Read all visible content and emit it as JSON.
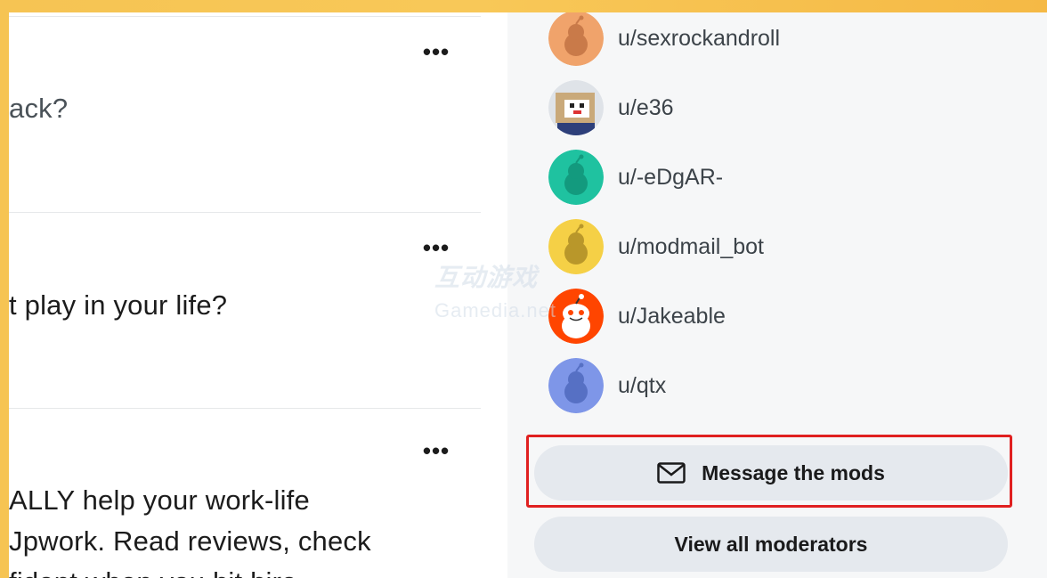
{
  "feed": {
    "more_label": "•••",
    "posts": [
      {
        "title_lines": [
          "ack?"
        ]
      },
      {
        "title_lines": [
          "t play in your life?"
        ]
      },
      {
        "title_lines": [
          "ALLY help your work-life",
          "Jpwork. Read reviews, check",
          "fident when you hit hire"
        ]
      }
    ]
  },
  "sidebar": {
    "moderators": [
      {
        "name": "u/sexrockandroll",
        "avatar_color": "#f0a36b",
        "avatar_icon": "snoo-avatar-icon"
      },
      {
        "name": "u/e36",
        "avatar_color": "#c9a97a",
        "avatar_icon": "custom-pixel-avatar-icon"
      },
      {
        "name": "u/-eDgAR-",
        "avatar_color": "#1fc2a0",
        "avatar_icon": "snoo-avatar-icon"
      },
      {
        "name": "u/modmail_bot",
        "avatar_color": "#f5d046",
        "avatar_icon": "snoo-avatar-icon"
      },
      {
        "name": "u/Jakeable",
        "avatar_color": "#ff4500",
        "avatar_icon": "snoo-avatar-icon"
      },
      {
        "name": "u/qtx",
        "avatar_color": "#7e96e8",
        "avatar_icon": "snoo-avatar-icon"
      }
    ],
    "message_mods_label": "Message the mods",
    "view_all_label": "View all moderators"
  },
  "watermark": {
    "line1": "互动游戏",
    "line2": "Gamedia.net"
  },
  "colors": {
    "highlight": "#e02020",
    "button_bg": "#e5e9ee",
    "frame_border": "#f6c453"
  }
}
